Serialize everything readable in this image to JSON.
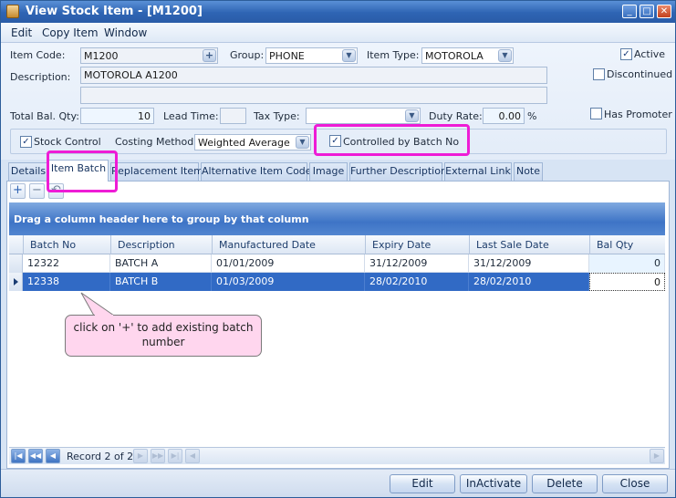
{
  "window": {
    "title": "View Stock Item - [M1200]",
    "controls": [
      "_",
      "□",
      "✕"
    ]
  },
  "menu": [
    "Edit",
    "Copy Item",
    "Window"
  ],
  "form": {
    "item_code_label": "Item Code:",
    "item_code": "M1200",
    "group_label": "Group:",
    "group": "PHONE",
    "item_type_label": "Item Type:",
    "item_type": "MOTOROLA",
    "description_label": "Description:",
    "description": "MOTOROLA A1200",
    "description2": "",
    "active_label": "Active",
    "active_checked": true,
    "discontinued_label": "Discontinued",
    "discontinued_checked": false,
    "total_bal_qty_label": "Total Bal. Qty:",
    "total_bal_qty": "10",
    "lead_time_label": "Lead Time:",
    "lead_time": "",
    "tax_type_label": "Tax Type:",
    "tax_type": "",
    "duty_rate_label": "Duty Rate:",
    "duty_rate": "0.00",
    "duty_rate_unit": "%",
    "has_promoter_label": "Has Promoter",
    "has_promoter_checked": false,
    "stock_control_label": "Stock Control",
    "stock_control_checked": true,
    "costing_method_label": "Costing Method:",
    "costing_method": "Weighted Average",
    "batch_label": "Controlled by Batch No",
    "batch_checked": true
  },
  "tabs": [
    {
      "label": "Details"
    },
    {
      "label": "Item Batch"
    },
    {
      "label": "Replacement Item"
    },
    {
      "label": "Alternative Item Code"
    },
    {
      "label": "Image"
    },
    {
      "label": "Further Description"
    },
    {
      "label": "External Link"
    },
    {
      "label": "Note"
    }
  ],
  "active_tab": "Item Batch",
  "grid": {
    "group_hint": "Drag a column header here to group by that column",
    "columns": [
      "Batch No",
      "Description",
      "Manufactured Date",
      "Expiry Date",
      "Last Sale Date",
      "Bal Qty"
    ],
    "rows": [
      {
        "batch_no": "12322",
        "description": "BATCH A",
        "manufactured": "01/01/2009",
        "expiry": "31/12/2009",
        "last_sale": "31/12/2009",
        "bal_qty": "0"
      },
      {
        "batch_no": "12338",
        "description": "BATCH B",
        "manufactured": "01/03/2009",
        "expiry": "28/02/2010",
        "last_sale": "28/02/2010",
        "bal_qty": "0"
      }
    ],
    "selected_row": 2
  },
  "callout": "click on '+' to add existing batch number",
  "navigator": {
    "record_text": "Record 2 of 2"
  },
  "buttons": {
    "edit": "Edit",
    "inactivate": "InActivate",
    "delete": "Delete",
    "close": "Close"
  },
  "colors": {
    "title_bar": "#2e64b3",
    "selected_row": "#316ac5",
    "highlight": "#ee1cd6",
    "callout_bg": "#ffd6ee"
  },
  "icons": {
    "add": "plus-icon",
    "remove": "minus-icon",
    "undo": "undo-icon"
  }
}
